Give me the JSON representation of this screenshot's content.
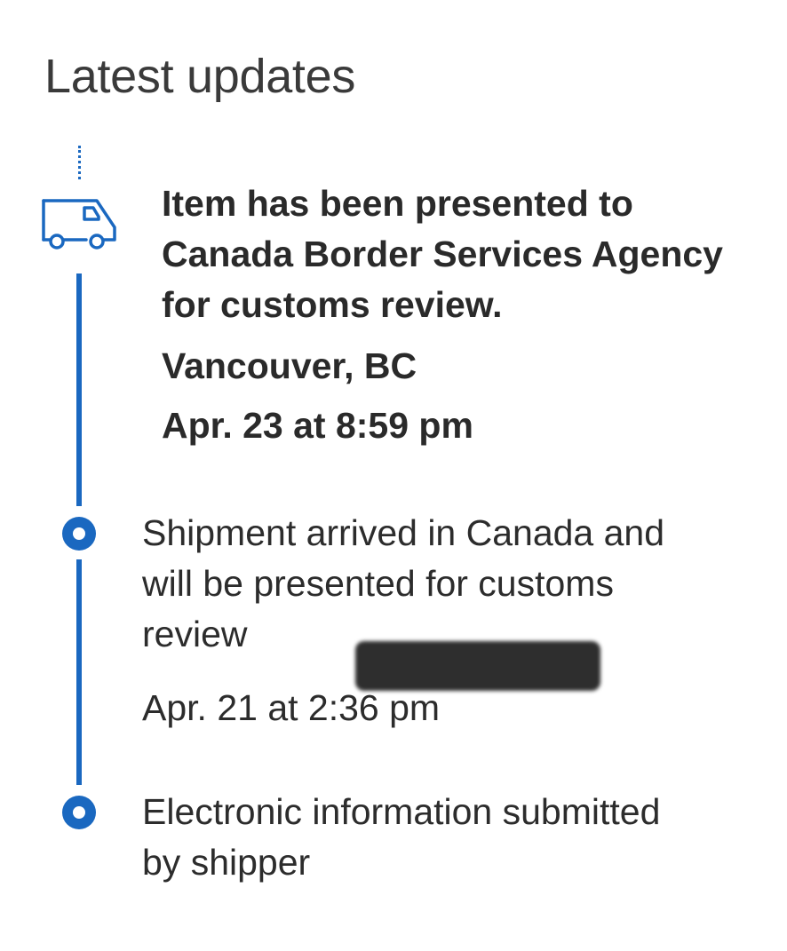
{
  "header": {
    "title": "Latest updates"
  },
  "timeline": {
    "accent_color": "#1a68c0",
    "events": [
      {
        "icon": "truck-icon",
        "lines": [
          "Item has been presented to",
          "Canada Border Services Agency",
          "for customs review."
        ],
        "location": "Vancouver, BC",
        "time": "Apr. 23 at 8:59 pm",
        "current": true
      },
      {
        "icon": "timeline-dot-icon",
        "lines": [
          "Shipment arrived in Canada and",
          "will be presented for customs",
          "review"
        ],
        "location_redacted": true,
        "time": "Apr. 21 at 2:36 pm"
      },
      {
        "icon": "timeline-dot-icon",
        "lines": [
          "Electronic information submitted",
          "by shipper"
        ]
      }
    ]
  }
}
